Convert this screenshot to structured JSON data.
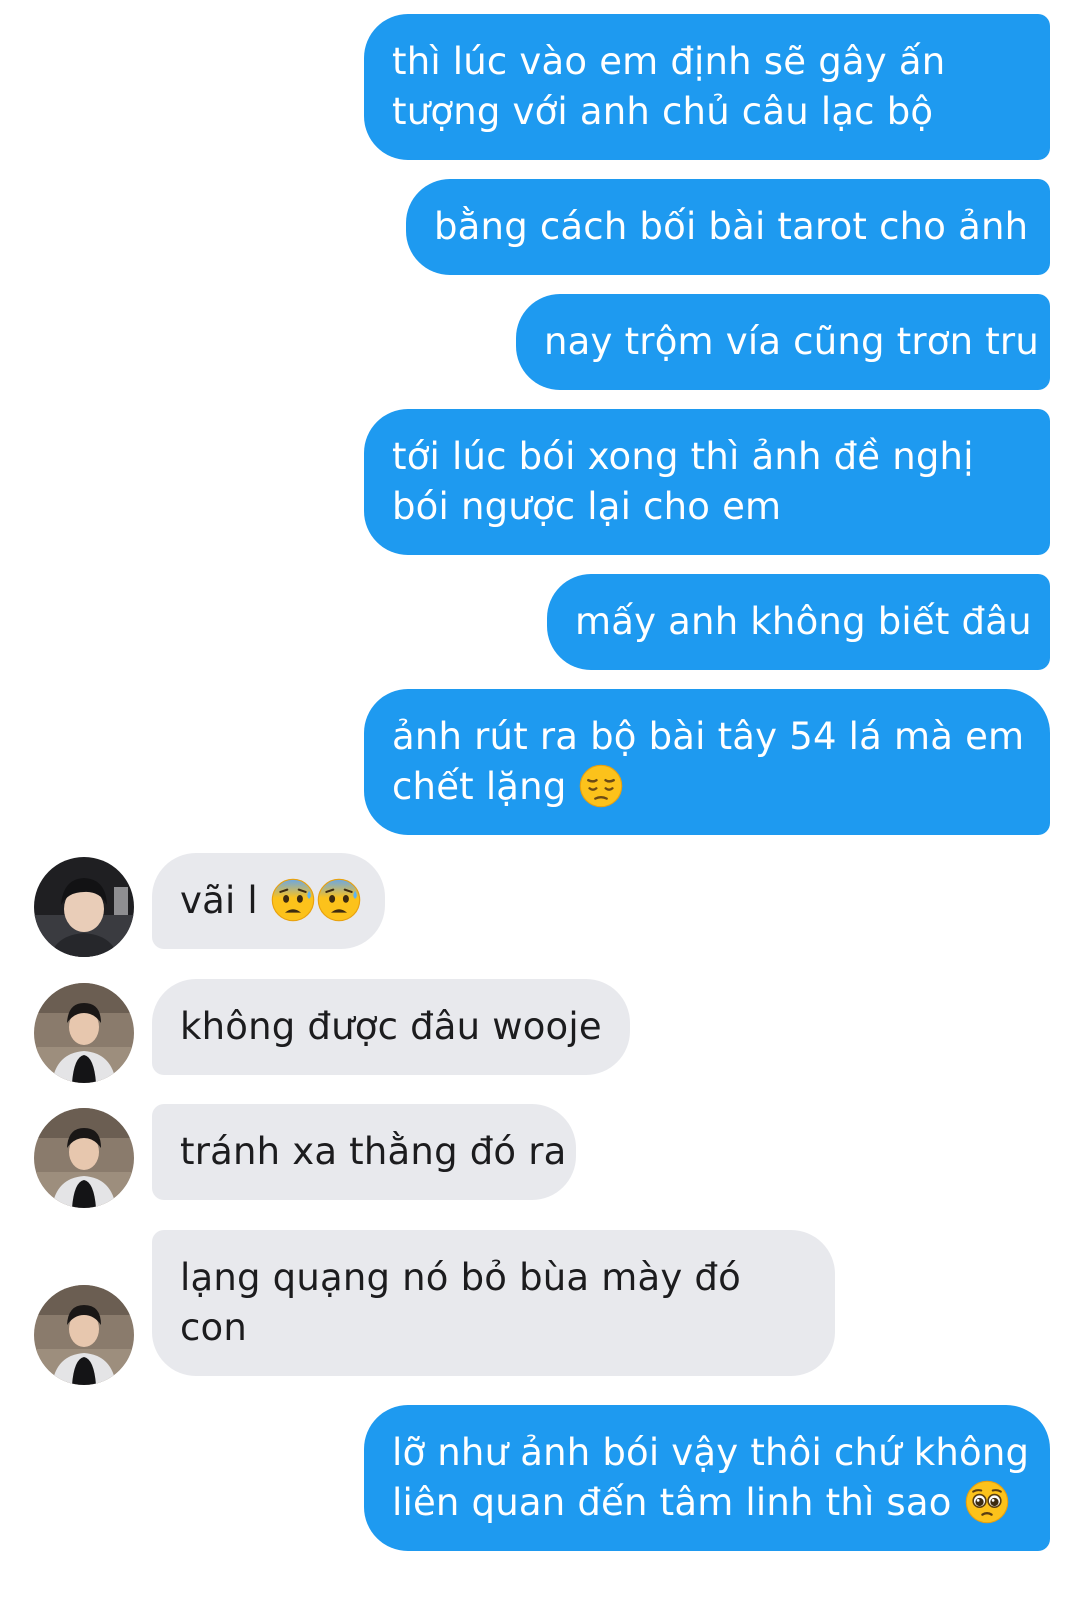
{
  "conversation": {
    "messages": [
      {
        "sender": "me",
        "lines": [
          "thì lúc vào em định sẽ gây ấn",
          "tượng với anh chủ câu lạc bộ"
        ]
      },
      {
        "sender": "me",
        "lines": [
          "bằng cách bối bài tarot cho ảnh"
        ]
      },
      {
        "sender": "me",
        "lines": [
          "nay trộm vía cũng trơn tru"
        ]
      },
      {
        "sender": "me",
        "lines": [
          "tới lúc bói xong thì ảnh đề nghị",
          "bói ngược lại cho em"
        ]
      },
      {
        "sender": "me",
        "lines": [
          "mấy anh không biết đâu"
        ]
      },
      {
        "sender": "me",
        "lines": [
          "ảnh rút ra bộ bài tây 54 lá mà em",
          "chết lặng"
        ],
        "emoji": [
          "pensive-face-icon"
        ]
      },
      {
        "sender": "friend-1",
        "lines": [
          "vãi l"
        ],
        "emoji": [
          "anxious-face-with-sweat-icon",
          "anxious-face-with-sweat-icon"
        ]
      },
      {
        "sender": "friend-2",
        "lines": [
          "không được đâu wooje"
        ]
      },
      {
        "sender": "friend-2",
        "lines": [
          "tránh xa thằng đó ra"
        ]
      },
      {
        "sender": "friend-2",
        "lines": [
          "lạng quạng nó bỏ bùa mày đó",
          "con"
        ]
      },
      {
        "sender": "me",
        "lines": [
          "lỡ như ảnh bói vậy thôi chứ không",
          "liên quan đến tâm linh thì sao"
        ],
        "emoji": [
          "pleading-face-icon"
        ]
      }
    ]
  },
  "colors": {
    "sent_bubble": "#1e9af0",
    "sent_text": "#ffffff",
    "received_bubble": "#e8e9ed",
    "received_text": "#1c1c1e",
    "background": "#ffffff"
  }
}
